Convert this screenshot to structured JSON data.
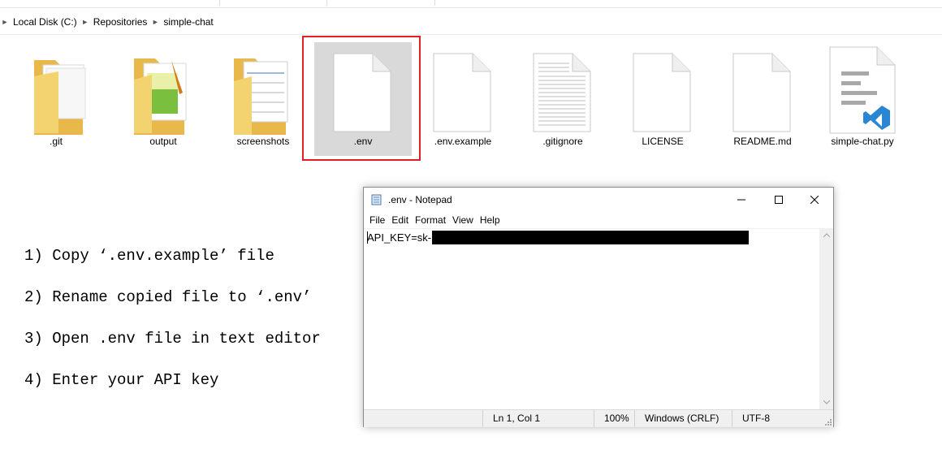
{
  "breadcrumb": {
    "items": [
      "Local Disk (C:)",
      "Repositories",
      "simple-chat"
    ]
  },
  "files": [
    {
      "name": ".git",
      "icon": "folder-icon"
    },
    {
      "name": "output",
      "icon": "folder-image-icon"
    },
    {
      "name": "screenshots",
      "icon": "folder-document-icon"
    },
    {
      "name": ".env",
      "icon": "blank-file-icon",
      "selected": true
    },
    {
      "name": ".env.example",
      "icon": "blank-file-icon"
    },
    {
      "name": ".gitignore",
      "icon": "text-file-icon"
    },
    {
      "name": "LICENSE",
      "icon": "blank-file-icon"
    },
    {
      "name": "README.md",
      "icon": "blank-file-icon"
    },
    {
      "name": "simple-chat.py",
      "icon": "vscode-file-icon"
    }
  ],
  "instructions": [
    "1) Copy ‘.env.example’ file",
    "2) Rename copied file to ‘.env’",
    "3) Open .env file in text editor",
    "4) Enter your API key"
  ],
  "notepad": {
    "title": ".env - Notepad",
    "menu": [
      "File",
      "Edit",
      "Format",
      "View",
      "Help"
    ],
    "content_prefix": "API_KEY=sk-",
    "status": {
      "position": "Ln 1, Col 1",
      "zoom": "100%",
      "line_endings": "Windows (CRLF)",
      "encoding": "UTF-8"
    }
  },
  "colors": {
    "highlight_border": "#e02020",
    "selection_bg": "#d9d9d9",
    "folder_yellow": "#f3d36f",
    "vscode_blue": "#2a86d3"
  }
}
